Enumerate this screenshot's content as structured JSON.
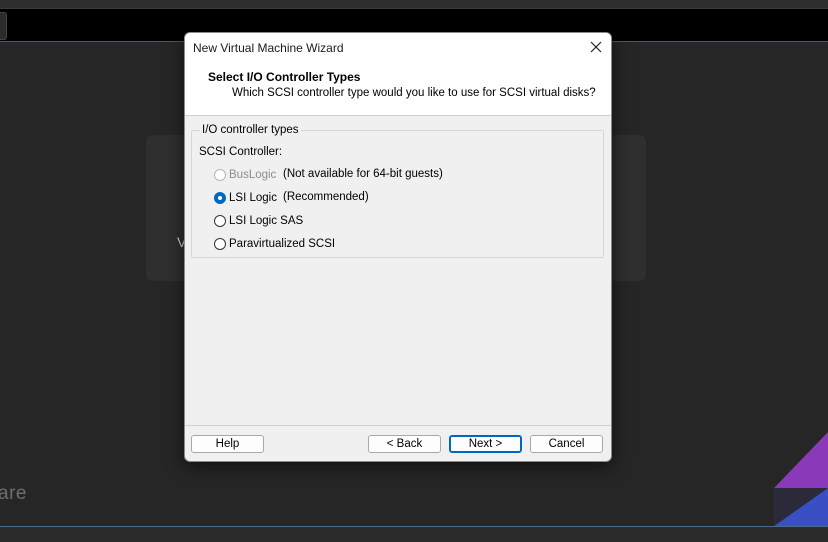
{
  "background": {
    "card_fragment": "V",
    "brand_fragment": "are"
  },
  "dialog": {
    "title": "New Virtual Machine Wizard",
    "header_title": "Select I/O Controller Types",
    "header_subtitle": "Which SCSI controller type would you like to use for SCSI virtual disks?",
    "group_title": "I/O controller types",
    "group_label": "SCSI Controller:",
    "options": [
      {
        "label": "BusLogic",
        "note": "(Not available for 64-bit guests)",
        "selected": false,
        "disabled": true
      },
      {
        "label": "LSI Logic",
        "note": "(Recommended)",
        "selected": true,
        "disabled": false
      },
      {
        "label": "LSI Logic SAS",
        "note": "",
        "selected": false,
        "disabled": false
      },
      {
        "label": "Paravirtualized SCSI",
        "note": "",
        "selected": false,
        "disabled": false
      }
    ],
    "buttons": {
      "help": "Help",
      "back": "< Back",
      "next": "Next >",
      "cancel": "Cancel"
    }
  },
  "colors": {
    "accent": "#0067c0",
    "background": "#262626",
    "dialog_bg": "#f0f0f0"
  }
}
